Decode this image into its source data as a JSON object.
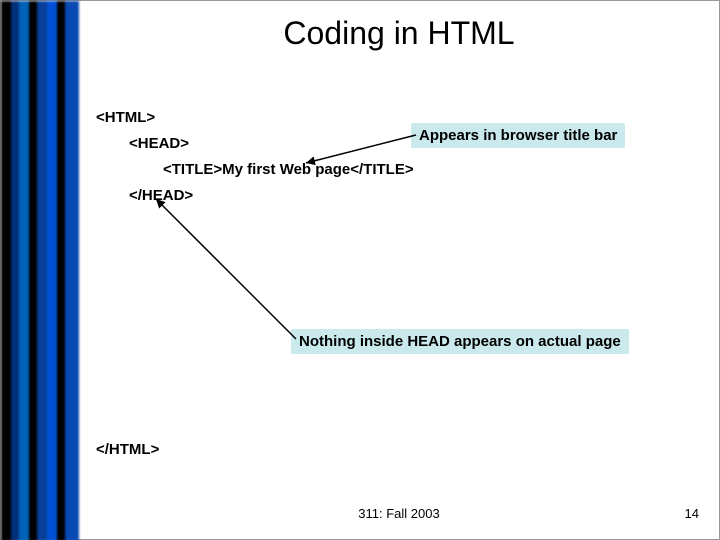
{
  "title": "Coding in HTML",
  "code": {
    "html_open": "<HTML>",
    "head_open": "<HEAD>",
    "title_line": "<TITLE>My first Web page</TITLE>",
    "head_close": "</HEAD>",
    "html_close": "</HTML>"
  },
  "callouts": {
    "appears": "Appears in browser title bar",
    "nothing": "Nothing inside HEAD appears on actual page"
  },
  "footer": {
    "center": "311: Fall 2003",
    "page": "14"
  }
}
